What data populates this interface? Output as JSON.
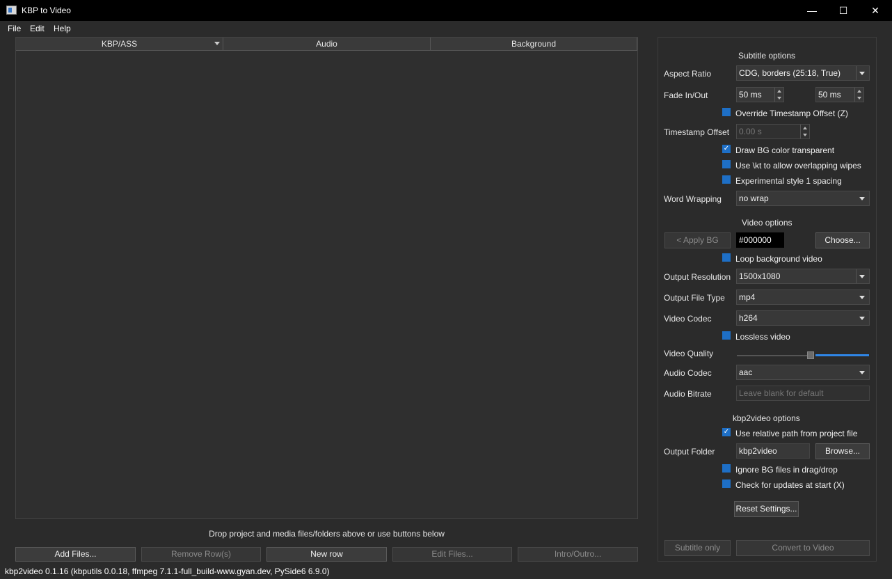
{
  "window": {
    "title": "KBP to Video",
    "minimize": "—",
    "maximize": "☐",
    "close": "✕"
  },
  "menu": [
    {
      "label": "File"
    },
    {
      "label": "Edit"
    },
    {
      "label": "Help"
    }
  ],
  "table": {
    "columns": [
      "KBP/ASS",
      "Audio",
      "Background"
    ]
  },
  "drop_hint": "Drop project and media files/folders above or use buttons below",
  "bottom_buttons": {
    "add_files": "Add Files...",
    "remove_rows": "Remove Row(s)",
    "new_row": "New row",
    "edit_files": "Edit Files...",
    "intro_outro": "Intro/Outro..."
  },
  "status": "kbp2video 0.1.16 (kbputils 0.0.18, ffmpeg 7.1.1-full_build-www.gyan.dev, PySide6 6.9.0)",
  "subtitle_options": {
    "heading": "Subtitle options",
    "aspect_ratio_label": "Aspect Ratio",
    "aspect_ratio_value": "CDG, borders (25:18, True)",
    "fade_label": "Fade In/Out",
    "fade_in": "50 ms",
    "fade_out": "50 ms",
    "override_ts": "Override Timestamp Offset (Z)",
    "ts_offset_label": "Timestamp Offset",
    "ts_offset_value": "0.00 s",
    "draw_bg_transparent": "Draw BG color transparent",
    "use_kt": "Use \\kt to allow overlapping wipes",
    "experimental_style": "Experimental style 1 spacing",
    "word_wrap_label": "Word Wrapping",
    "word_wrap_value": "no wrap"
  },
  "video_options": {
    "heading": "Video options",
    "apply_bg": "< Apply BG",
    "color_value": "#000000",
    "choose": "Choose...",
    "loop_bg": "Loop background video",
    "resolution_label": "Output Resolution",
    "resolution_value": "1500x1080",
    "file_type_label": "Output File Type",
    "file_type_value": "mp4",
    "codec_label": "Video Codec",
    "codec_value": "h264",
    "lossless": "Lossless video",
    "quality_label": "Video Quality",
    "quality_level": 0.56,
    "audio_codec_label": "Audio Codec",
    "audio_codec_value": "aac",
    "audio_bitrate_label": "Audio Bitrate",
    "audio_bitrate_placeholder": "Leave blank for default"
  },
  "kbp2video_options": {
    "heading": "kbp2video options",
    "relative_path": "Use relative path from project file",
    "output_folder_label": "Output Folder",
    "output_folder_value": "kbp2video",
    "browse": "Browse...",
    "ignore_bg": "Ignore BG files in drag/drop",
    "check_updates": "Check for updates at start (X)",
    "reset": "Reset Settings..."
  },
  "actions": {
    "subtitle_only": "Subtitle only",
    "convert": "Convert to Video"
  },
  "colors": {
    "accent": "#1e6fc6",
    "background": "#2b2b2b",
    "titlebar": "#000000"
  }
}
